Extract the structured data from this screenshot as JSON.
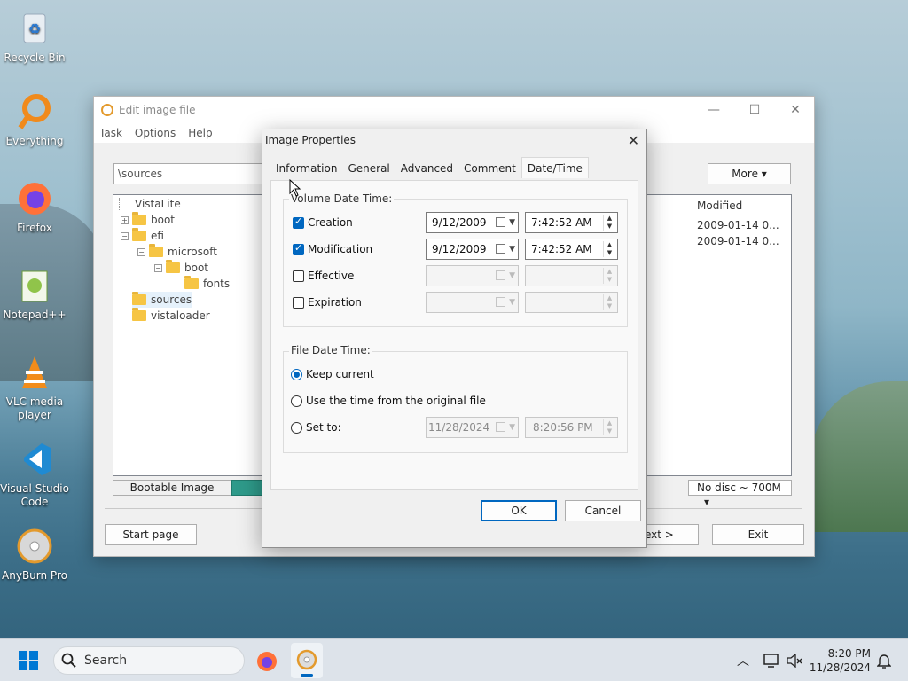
{
  "desktop": {
    "icons": [
      {
        "label": "Recycle Bin",
        "icon": "recycle-bin-icon"
      },
      {
        "label": "Everything",
        "icon": "everything-search-icon"
      },
      {
        "label": "Firefox",
        "icon": "firefox-icon"
      },
      {
        "label": "Notepad++",
        "icon": "notepad-plus-plus-icon"
      },
      {
        "label": "VLC media player",
        "icon": "vlc-icon"
      },
      {
        "label": "Visual Studio Code",
        "icon": "vscode-icon"
      },
      {
        "label": "AnyBurn Pro",
        "icon": "anyburn-icon"
      }
    ]
  },
  "main_window": {
    "title": "Edit image file",
    "menu": [
      "Task",
      "Options",
      "Help"
    ],
    "path": "\\sources",
    "more_label": "More",
    "tree": [
      {
        "name": "VistaLite",
        "level": 0
      },
      {
        "name": "boot",
        "level": 1
      },
      {
        "name": "efi",
        "level": 1
      },
      {
        "name": "microsoft",
        "level": 2
      },
      {
        "name": "boot",
        "level": 3
      },
      {
        "name": "fonts",
        "level": 4
      },
      {
        "name": "sources",
        "level": 1
      },
      {
        "name": "vistaloader",
        "level": 1
      }
    ],
    "list_header_modified": "Modified",
    "list_rows": [
      "2009-01-14 0...",
      "2009-01-14 0..."
    ],
    "bootable_label": "Bootable Image",
    "disc_label": "No disc ~ 700M",
    "start_page_label": "Start page",
    "next_label": "ext >",
    "exit_label": "Exit"
  },
  "dialog": {
    "title": "Image Properties",
    "tabs": [
      "Information",
      "General",
      "Advanced",
      "Comment",
      "Date/Time"
    ],
    "active_tab": "Date/Time",
    "volume_group": "Volume Date Time:",
    "rows": [
      {
        "label": "Creation",
        "checked": true,
        "date": "9/12/2009",
        "time": "7:42:52 AM"
      },
      {
        "label": "Modification",
        "checked": true,
        "date": "9/12/2009",
        "time": "7:42:52 AM"
      },
      {
        "label": "Effective",
        "checked": false,
        "date": "",
        "time": ""
      },
      {
        "label": "Expiration",
        "checked": false,
        "date": "",
        "time": ""
      }
    ],
    "file_group": "File Date Time:",
    "radio_keep": "Keep current",
    "radio_original": "Use the time from the original file",
    "radio_setto": "Set to:",
    "setto_date": "11/28/2024",
    "setto_time": "8:20:56 PM",
    "ok_label": "OK",
    "cancel_label": "Cancel"
  },
  "taskbar": {
    "search_placeholder": "Search",
    "time": "8:20 PM",
    "date": "11/28/2024"
  }
}
